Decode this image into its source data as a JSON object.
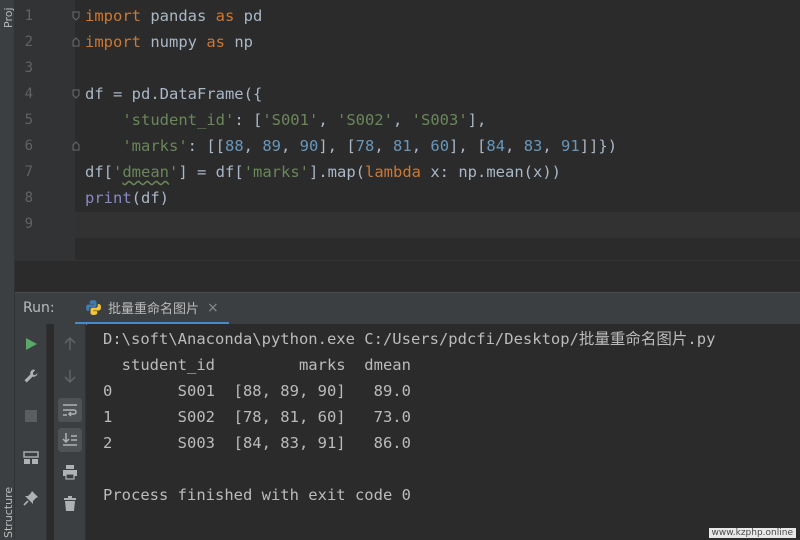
{
  "side_tabs": {
    "project": "Proj",
    "structure": "Structure"
  },
  "editor": {
    "line_numbers": [
      "1",
      "2",
      "3",
      "4",
      "5",
      "6",
      "7",
      "8",
      "9"
    ],
    "lines": [
      [
        {
          "t": "import",
          "c": "kw"
        },
        {
          "t": " pandas "
        },
        {
          "t": "as",
          "c": "kw"
        },
        {
          "t": " pd"
        }
      ],
      [
        {
          "t": "import",
          "c": "kw"
        },
        {
          "t": " numpy "
        },
        {
          "t": "as",
          "c": "kw"
        },
        {
          "t": " np"
        }
      ],
      [],
      [
        {
          "t": "df = pd.DataFrame({"
        }
      ],
      [
        {
          "t": "    "
        },
        {
          "t": "'student_id'",
          "c": "str"
        },
        {
          "t": ": ["
        },
        {
          "t": "'S001'",
          "c": "str"
        },
        {
          "t": ", "
        },
        {
          "t": "'S002'",
          "c": "str"
        },
        {
          "t": ", "
        },
        {
          "t": "'S003'",
          "c": "str"
        },
        {
          "t": "],"
        }
      ],
      [
        {
          "t": "    "
        },
        {
          "t": "'marks'",
          "c": "str"
        },
        {
          "t": ": [["
        },
        {
          "t": "88",
          "c": "num"
        },
        {
          "t": ", "
        },
        {
          "t": "89",
          "c": "num"
        },
        {
          "t": ", "
        },
        {
          "t": "90",
          "c": "num"
        },
        {
          "t": "], ["
        },
        {
          "t": "78",
          "c": "num"
        },
        {
          "t": ", "
        },
        {
          "t": "81",
          "c": "num"
        },
        {
          "t": ", "
        },
        {
          "t": "60",
          "c": "num"
        },
        {
          "t": "], ["
        },
        {
          "t": "84",
          "c": "num"
        },
        {
          "t": ", "
        },
        {
          "t": "83",
          "c": "num"
        },
        {
          "t": ", "
        },
        {
          "t": "91",
          "c": "num"
        },
        {
          "t": "]]})"
        }
      ],
      [
        {
          "t": "df["
        },
        {
          "t": "'",
          "c": "str"
        },
        {
          "t": "dmean",
          "c": "str squig"
        },
        {
          "t": "'",
          "c": "str"
        },
        {
          "t": "] = df["
        },
        {
          "t": "'marks'",
          "c": "str"
        },
        {
          "t": "].map("
        },
        {
          "t": "lambda",
          "c": "kw"
        },
        {
          "t": " x: np.mean(x))"
        }
      ],
      [
        {
          "t": "print",
          "c": "bi"
        },
        {
          "t": "(df)"
        }
      ],
      []
    ]
  },
  "run": {
    "label": "Run:",
    "tab_title": "批量重命名图片",
    "tab_close": "×",
    "console_lines": [
      "D:\\soft\\Anaconda\\python.exe C:/Users/pdcfi/Desktop/批量重命名图片.py",
      "  student_id         marks  dmean",
      "0       S001  [88, 89, 90]   89.0",
      "1       S002  [78, 81, 60]   73.0",
      "2       S003  [84, 83, 91]   86.0",
      "",
      "Process finished with exit code 0"
    ]
  },
  "watermark": "www.kzphp.online",
  "colors": {
    "keyword": "#cc7832",
    "string": "#6a8759",
    "number": "#6897bb",
    "builtin": "#8888c6",
    "run_green": "#59a869",
    "tab_underline": "#4a88c7"
  }
}
